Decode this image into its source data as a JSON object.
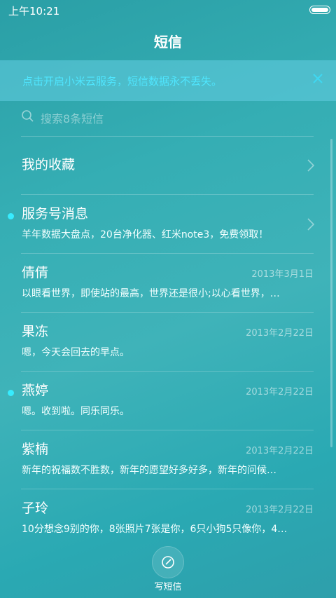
{
  "status_bar": {
    "time": "上午10:21"
  },
  "header": {
    "title": "短信"
  },
  "notice": {
    "text": "点击开启小米云服务，短信数据永不丢失。"
  },
  "search": {
    "placeholder": "搜索8条短信"
  },
  "favorites": {
    "label": "我的收藏"
  },
  "messages": [
    {
      "name": "服务号消息",
      "date": "",
      "preview": "羊年数据大盘点，20台净化器、红米note3，免费领取！",
      "unread": true
    },
    {
      "name": "倩倩",
      "date": "2013年3月1日",
      "preview": "以眼看世界，即使站的最高，世界还是很小;以心看世界，…",
      "unread": false
    },
    {
      "name": "果冻",
      "date": "2013年2月22日",
      "preview": "嗯，今天会回去的早点。",
      "unread": false
    },
    {
      "name": "燕婷",
      "date": "2013年2月22日",
      "preview": "嗯。收到啦。同乐同乐。",
      "unread": true
    },
    {
      "name": "紫楠",
      "date": "2013年2月22日",
      "preview": "新年的祝福数不胜数，新年的愿望好多好多，新年的问候…",
      "unread": false
    },
    {
      "name": "子玲",
      "date": "2013年2月22日",
      "preview": "10分想念9别的你，8张照片7张是你，6只小狗5只像你，4…",
      "unread": false
    }
  ],
  "compose": {
    "label": "写短信"
  },
  "colors": {
    "accent": "#37ecff",
    "notice_text": "#4fe6ff"
  }
}
